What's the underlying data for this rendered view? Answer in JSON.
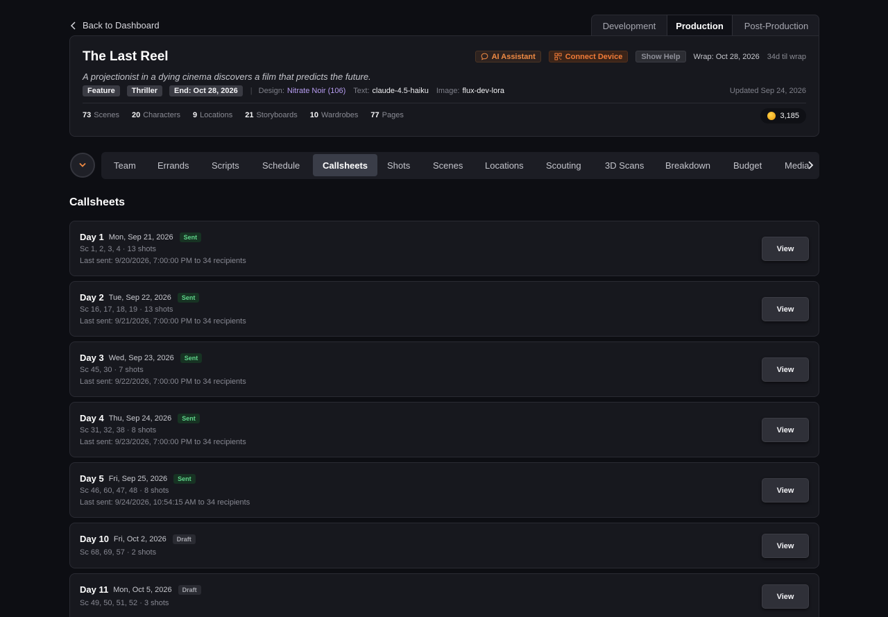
{
  "back": {
    "label": "Back to Dashboard",
    "icon": "chevron-left-icon"
  },
  "phase_tabs": [
    {
      "label": "Development",
      "active": false
    },
    {
      "label": "Production",
      "active": true
    },
    {
      "label": "Post-Production",
      "active": false
    }
  ],
  "project": {
    "title": "The Last Reel",
    "logline": "A projectionist in a dying cinema discovers a film that predicts the future.",
    "ai_assistant": "AI Assistant",
    "connect_device": "Connect Device",
    "show_help": "Show Help",
    "wrap": "Wrap: Oct 28, 2026",
    "til_wrap": "34d til wrap",
    "tags": [
      "Feature",
      "Thriller",
      "End: Oct 28, 2026"
    ],
    "separator": "|",
    "design_label": "Design:",
    "design_value": "Nitrate Noir (106)",
    "text_label": "Text:",
    "text_value": "claude-4.5-haiku",
    "image_label": "Image:",
    "image_value": "flux-dev-lora",
    "updated": "Updated Sep 24, 2026",
    "stats": [
      {
        "num": "73",
        "label": "Scenes"
      },
      {
        "num": "20",
        "label": "Characters"
      },
      {
        "num": "9",
        "label": "Locations"
      },
      {
        "num": "21",
        "label": "Storyboards"
      },
      {
        "num": "10",
        "label": "Wardrobes"
      },
      {
        "num": "77",
        "label": "Pages"
      }
    ],
    "credits": "3,185"
  },
  "nav_tabs": [
    {
      "label": "Team",
      "active": false
    },
    {
      "label": "Errands",
      "active": false
    },
    {
      "label": "Scripts",
      "active": false
    },
    {
      "label": "Schedule",
      "active": false
    },
    {
      "label": "Callsheets",
      "active": true
    },
    {
      "label": "Shots",
      "active": false
    },
    {
      "label": "Scenes",
      "active": false
    },
    {
      "label": "Locations",
      "active": false
    },
    {
      "label": "Scouting",
      "active": false
    },
    {
      "label": "3D Scans",
      "active": false
    },
    {
      "label": "Breakdown",
      "active": false
    },
    {
      "label": "Budget",
      "active": false
    },
    {
      "label": "Media",
      "active": false
    }
  ],
  "section_title": "Callsheets",
  "callsheets": [
    {
      "day": "Day 1",
      "date": "Mon, Sep 21, 2026",
      "status": "Sent",
      "scenes": "Sc 1, 2, 3, 4 · 13 shots",
      "last_sent": "Last sent: 9/20/2026, 7:00:00 PM to 34 recipients",
      "button": "View"
    },
    {
      "day": "Day 2",
      "date": "Tue, Sep 22, 2026",
      "status": "Sent",
      "scenes": "Sc 16, 17, 18, 19 · 13 shots",
      "last_sent": "Last sent: 9/21/2026, 7:00:00 PM to 34 recipients",
      "button": "View"
    },
    {
      "day": "Day 3",
      "date": "Wed, Sep 23, 2026",
      "status": "Sent",
      "scenes": "Sc 45, 30 · 7 shots",
      "last_sent": "Last sent: 9/22/2026, 7:00:00 PM to 34 recipients",
      "button": "View"
    },
    {
      "day": "Day 4",
      "date": "Thu, Sep 24, 2026",
      "status": "Sent",
      "scenes": "Sc 31, 32, 38 · 8 shots",
      "last_sent": "Last sent: 9/23/2026, 7:00:00 PM to 34 recipients",
      "button": "View"
    },
    {
      "day": "Day 5",
      "date": "Fri, Sep 25, 2026",
      "status": "Sent",
      "scenes": "Sc 46, 60, 47, 48 · 8 shots",
      "last_sent": "Last sent: 9/24/2026, 10:54:15 AM to 34 recipients",
      "button": "View"
    },
    {
      "day": "Day 10",
      "date": "Fri, Oct 2, 2026",
      "status": "Draft",
      "scenes": "Sc 68, 69, 57 · 2 shots",
      "last_sent": "",
      "button": "View"
    },
    {
      "day": "Day 11",
      "date": "Mon, Oct 5, 2026",
      "status": "Draft",
      "scenes": "Sc 49, 50, 51, 52 · 3 shots",
      "last_sent": "",
      "button": "View"
    }
  ],
  "colors": {
    "background": "#0d0e13",
    "card": "#17181e",
    "accent_orange": "#f27b37",
    "design_purple": "#b69cf0",
    "sent_green": "#5fd48a"
  }
}
